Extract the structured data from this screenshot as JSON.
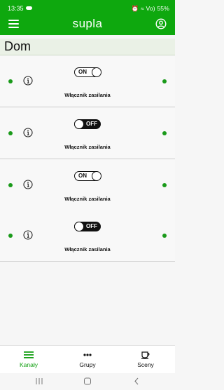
{
  "status_bar": {
    "time": "13:35",
    "right_text": "⏰ ≈ Vo) 55%"
  },
  "app": {
    "title": "supla",
    "accent_color": "#0ea80e"
  },
  "location": {
    "name": "Dom"
  },
  "channels": [
    {
      "state": "ON",
      "label": "Włącznik zasilania"
    },
    {
      "state": "OFF",
      "label": "Włącznik zasilania"
    },
    {
      "state": "ON",
      "label": "Włącznik zasilania"
    },
    {
      "state": "OFF",
      "label": "Włącznik zasilania"
    }
  ],
  "bottom_nav": [
    {
      "label": "Kanały",
      "icon": "list-icon",
      "active": true
    },
    {
      "label": "Grupy",
      "icon": "dots-icon",
      "active": false
    },
    {
      "label": "Sceny",
      "icon": "cup-icon",
      "active": false
    }
  ]
}
